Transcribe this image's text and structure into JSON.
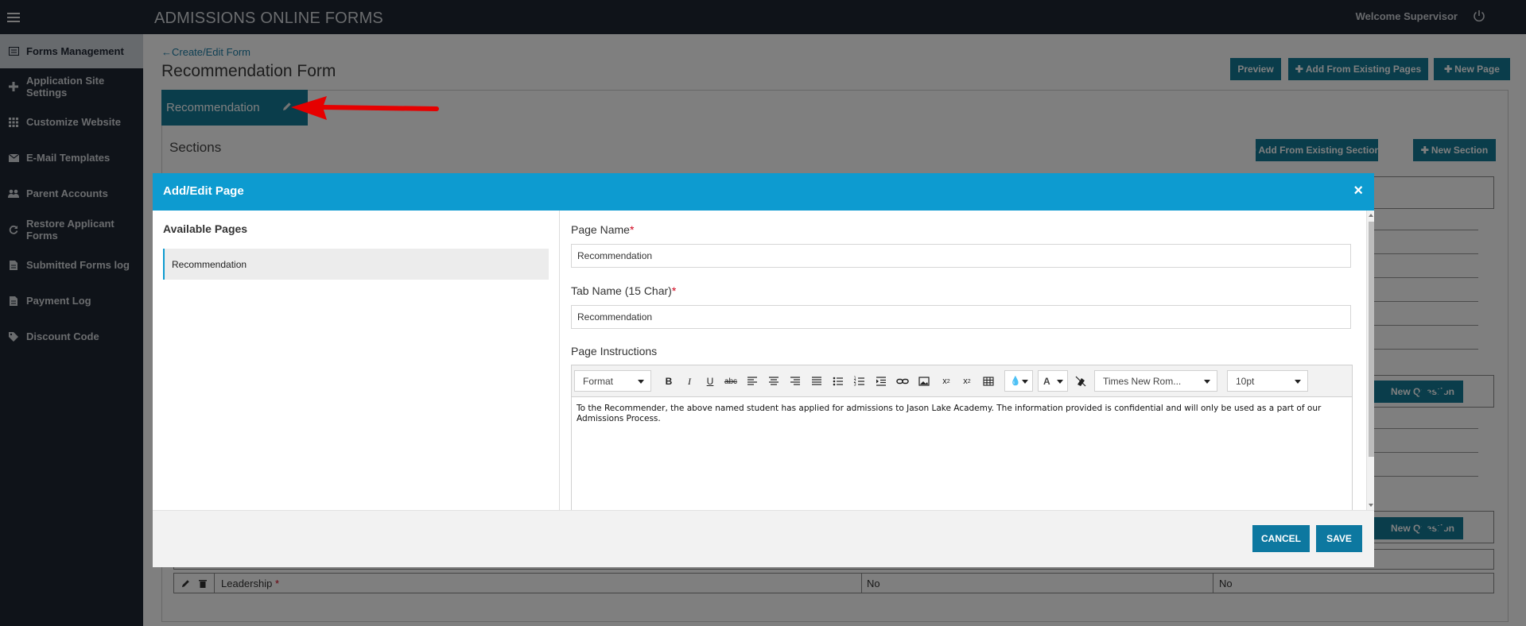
{
  "topbar": {
    "title": "ADMISSIONS ONLINE FORMS",
    "welcome": "Welcome Supervisor"
  },
  "sidebar": {
    "items": [
      {
        "label": "Forms Management",
        "icon": "form-icon",
        "active": true
      },
      {
        "label": "Application Site Settings",
        "icon": "plus-icon",
        "active": false
      },
      {
        "label": "Customize Website",
        "icon": "grid-icon",
        "active": false
      },
      {
        "label": "E-Mail Templates",
        "icon": "envelope-icon",
        "active": false
      },
      {
        "label": "Parent Accounts",
        "icon": "users-icon",
        "active": false
      },
      {
        "label": "Restore Applicant Forms",
        "icon": "refresh-icon",
        "active": false
      },
      {
        "label": "Submitted Forms log",
        "icon": "document-icon",
        "active": false
      },
      {
        "label": "Payment Log",
        "icon": "document-icon",
        "active": false
      },
      {
        "label": "Discount Code",
        "icon": "tag-icon",
        "active": false
      }
    ]
  },
  "main": {
    "breadcrumb": "Create/Edit Form",
    "title": "Recommendation Form",
    "buttons": {
      "preview": "Preview",
      "add_existing_pages": "Add From Existing Pages",
      "new_page": "New Page",
      "add_existing_sections": "Add From Existing Sections",
      "new_section": "New Section",
      "new_question_1": "New Question",
      "new_question_2": "New Question"
    },
    "page_tab": "Recommendation",
    "sections_label": "Sections",
    "bottom_row": {
      "name": "Leadership",
      "req": "*",
      "col2": "No",
      "col3": "No"
    }
  },
  "modal": {
    "title": "Add/Edit Page",
    "close": "×",
    "available_pages_title": "Available Pages",
    "available_pages": [
      "Recommendation"
    ],
    "page_name_label": "Page Name",
    "page_name_value": "Recommendation",
    "tab_name_label": "Tab Name (15 Char)",
    "tab_name_value": "Recommendation",
    "required_mark": "*",
    "instructions_label": "Page Instructions",
    "toolbar": {
      "format": "Format",
      "font_family": "Times New Rom...",
      "font_size": "10pt",
      "text_color": "A"
    },
    "instructions_text": "To the Recommender, the above named student has applied for admissions to Jason Lake Academy. The information provided is confidential and will only be used as a part of our Admissions Process.",
    "cancel": "CANCEL",
    "save": "SAVE"
  },
  "colors": {
    "sidebar_bg": "#1f2633",
    "teal": "#157a97",
    "modal_header": "#0d9bd0",
    "annotation": "#e60000"
  }
}
